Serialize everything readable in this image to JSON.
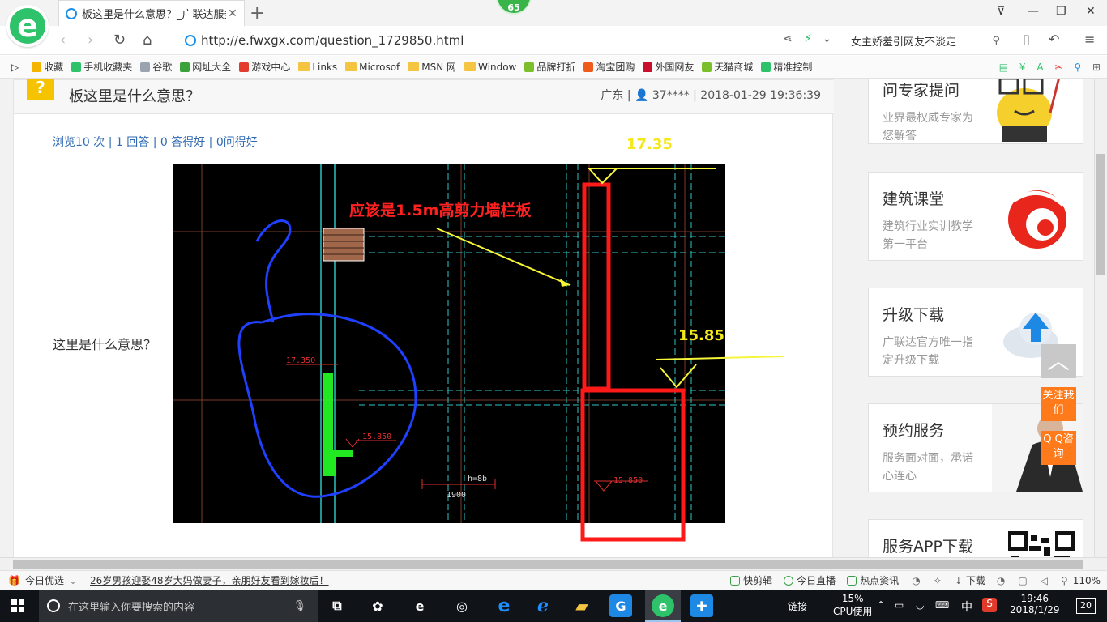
{
  "browser": {
    "tab_title": "板这里是什么意思？_广联达服务",
    "tab_close": "✕",
    "new_tab": "+",
    "badge": "65",
    "url": "http://e.fwxgx.com/question_1729850.html",
    "search_text": "女主娇羞引网友不淡定",
    "window_controls": [
      "⊽",
      "—",
      "❐",
      "✕"
    ]
  },
  "bookmarks": [
    {
      "label": "收藏",
      "icon": "star-icon",
      "color": "#f5b400"
    },
    {
      "label": "手机收藏夹",
      "icon": "phone-icon",
      "color": "#2ec26a"
    },
    {
      "label": "谷歌",
      "icon": "page-icon",
      "color": "#9aa4b0"
    },
    {
      "label": "网址大全",
      "icon": "globe-icon",
      "color": "#3aa23a"
    },
    {
      "label": "游戏中心",
      "icon": "game-icon",
      "color": "#e33b2e"
    },
    {
      "label": "Links",
      "icon": "folder-icon",
      "color": "#f5c542"
    },
    {
      "label": "Microsof",
      "icon": "folder-icon",
      "color": "#f5c542"
    },
    {
      "label": "MSN 网",
      "icon": "folder-icon",
      "color": "#f5c542"
    },
    {
      "label": "Window",
      "icon": "folder-icon",
      "color": "#f5c542"
    },
    {
      "label": "品牌打折",
      "icon": "leaf-icon",
      "color": "#7bbf2a"
    },
    {
      "label": "淘宝团购",
      "icon": "taobao-icon",
      "color": "#f05a1a"
    },
    {
      "label": "外国网友",
      "icon": "flag-icon",
      "color": "#c8102e"
    },
    {
      "label": "天猫商城",
      "icon": "leaf-icon",
      "color": "#7bbf2a"
    },
    {
      "label": "精准控制",
      "icon": "chat-icon",
      "color": "#2ec26a"
    }
  ],
  "question": {
    "icon_text": "?",
    "title": "板这里是什么意思？",
    "meta": "广东 | 👤 37**** | 2018-01-29 19:36:39",
    "stats": "浏览10 次 | 1 回答 | 0 答得好 | 0问得好",
    "body": "这里是什么意思？"
  },
  "cad": {
    "annotation": "应该是1.5m高剪力墙栏板",
    "elev_top": "17.35",
    "elev_mid": "15.85",
    "small_label_1": "17.350",
    "small_label_2": "15.850",
    "small_label_3": "15.850",
    "dim_label": "1900",
    "beam_label": "h=8b"
  },
  "sidebar": [
    {
      "title": "问专家提问",
      "desc": "业界最权威专家为您解答",
      "art": "mascot-icon"
    },
    {
      "title": "建筑课堂",
      "desc": "建筑行业实训教学第一平台",
      "art": "flame-logo-icon"
    },
    {
      "title": "升级下载",
      "desc": "广联达官方唯一指定升级下载",
      "art": "cloud-upload-icon"
    },
    {
      "title": "预约服务",
      "desc": "服务面对面，承诺心连心",
      "art": "person-photo-icon"
    },
    {
      "title": "服务APP下载",
      "desc": "",
      "art": "qr-code-icon"
    }
  ],
  "floating": {
    "top": "︿",
    "follow": "关注我们",
    "qq": "Q Q咨询"
  },
  "statusbar": {
    "left_label": "今日优选",
    "news": "26岁男孩迎娶48岁大妈做妻子，亲朋好友看到嫁妆后！",
    "items": [
      "快剪辑",
      "今日直播",
      "热点资讯",
      "下载"
    ],
    "zoom": "110%"
  },
  "taskbar": {
    "search_placeholder": "在这里输入你要搜索的内容",
    "link_label": "链接",
    "cpu_percent": "15%",
    "cpu_label": "CPU使用",
    "ime": "中",
    "time": "19:46",
    "date": "2018/1/29",
    "notif_count": "20"
  }
}
